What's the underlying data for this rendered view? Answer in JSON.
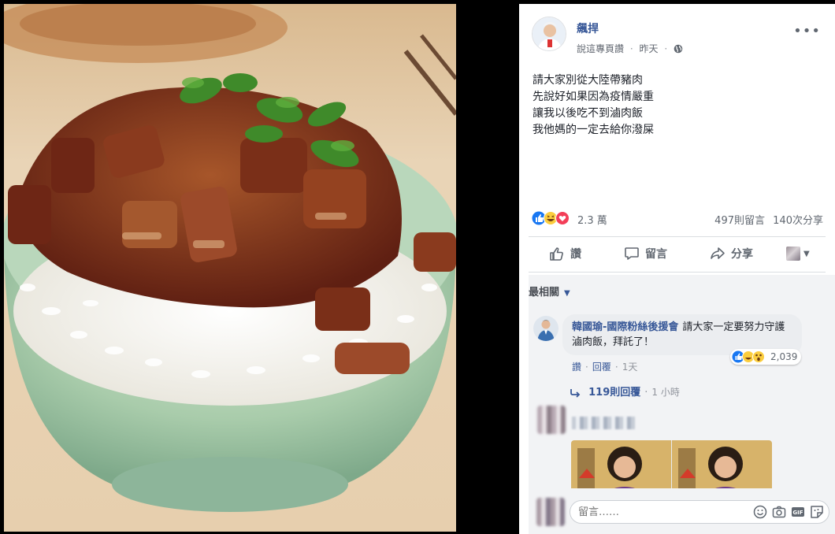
{
  "post": {
    "page_name": "飆捍",
    "meta_prefix": "說這專頁讚",
    "meta_time": "昨天",
    "body_lines": [
      "請大家別從大陸帶豬肉",
      "先說好如果因為疫情嚴重",
      "讓我以後吃不到滷肉飯",
      "我他媽的一定去給你潑屎"
    ],
    "more_icon": "ellipsis-icon"
  },
  "stats": {
    "reactions_count": "2.3 萬",
    "comments_count": "497則留言",
    "shares_count": "140次分享",
    "reaction_types": [
      "like",
      "haha",
      "love"
    ]
  },
  "actions": {
    "like": "讚",
    "comment": "留言",
    "share": "分享"
  },
  "sorter": {
    "label": "最相關"
  },
  "comment": {
    "author": "韓國瑜-國際粉絲後援會",
    "text": "請大家一定要努力守護滷肉飯，拜託了！",
    "reactions_count": "2,039",
    "like_link": "讚",
    "reply_link": "回覆",
    "time": "1天",
    "replies_link": "119則回覆",
    "replies_time": "1 小時"
  },
  "composer": {
    "placeholder": "留言……",
    "icons": [
      "emoji-icon",
      "camera-icon",
      "gif-icon",
      "sticker-icon"
    ]
  },
  "colors": {
    "link_blue": "#385898",
    "like_blue": "#1877f2",
    "love_red": "#f33e58",
    "haha_yellow": "#fbcd3e"
  }
}
